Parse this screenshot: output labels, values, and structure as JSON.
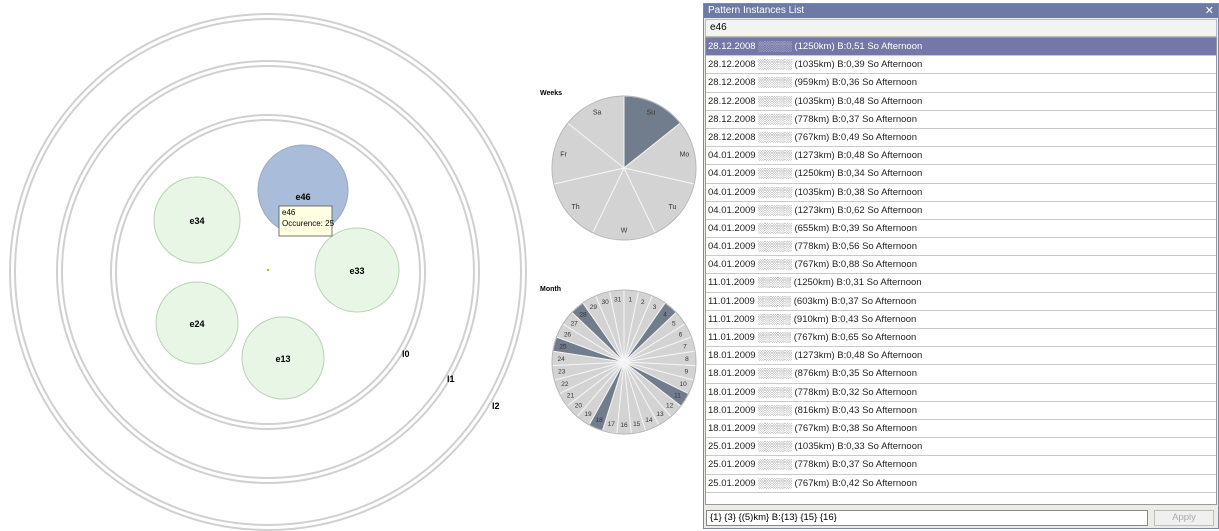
{
  "levels": [
    "l0",
    "l1",
    "l2"
  ],
  "nodes": [
    {
      "label": "e46",
      "selected": true
    },
    {
      "label": "e34"
    },
    {
      "label": "e33"
    },
    {
      "label": "e24"
    },
    {
      "label": "e13"
    }
  ],
  "tooltip": {
    "line1": "e46",
    "line2": "Occurence: 25"
  },
  "weeks": {
    "title": "Weeks",
    "days": [
      "Su",
      "Mo",
      "Tu",
      "W",
      "Th",
      "Fr",
      "Sa"
    ],
    "highlighted": [
      "Su"
    ]
  },
  "month": {
    "title": "Month",
    "days": [
      "1",
      "2",
      "3",
      "4",
      "5",
      "6",
      "7",
      "8",
      "9",
      "10",
      "11",
      "12",
      "13",
      "14",
      "15",
      "16",
      "17",
      "18",
      "19",
      "20",
      "21",
      "22",
      "23",
      "24",
      "25",
      "26",
      "27",
      "28",
      "29",
      "30",
      "31"
    ],
    "highlighted": [
      "4",
      "11",
      "18",
      "25",
      "28"
    ]
  },
  "colors": {
    "highlight": "#717d8c",
    "pie": "#d3d3d3",
    "selected_node": "#a9bcd9",
    "node": "#e8f6e5",
    "selected_row": "#7478a8"
  },
  "panel": {
    "title": "Pattern Instances List",
    "filter": "e46",
    "rows": [
      "28.12.2008 ​░░░░░ (1250km) B:0,51 So Afternoon",
      "28.12.2008 ░░░░░ (1035km) B:0,39 So Afternoon",
      "28.12.2008 ░░░░░ (959km) B:0,36 So Afternoon",
      "28.12.2008 ░░░░░ (1035km) B:0,48 So Afternoon",
      "28.12.2008 ░░░░░ (778km) B:0,37 So Afternoon",
      "28.12.2008 ░░░░░ (767km) B:0,49 So Afternoon",
      "04.01.2009 ░░░░░ (1273km) B:0,48 So Afternoon",
      "04.01.2009 ░░░░░ (1250km) B:0,34 So Afternoon",
      "04.01.2009 ░░░░░ (1035km) B:0,38 So Afternoon",
      "04.01.2009 ░░░░░ (1273km) B:0,62 So Afternoon",
      "04.01.2009 ░░░░░ (655km) B:0,39 So Afternoon",
      "04.01.2009 ░░░░░ (778km) B:0,56 So Afternoon",
      "04.01.2009 ░░░░░ (767km) B:0,88 So Afternoon",
      "11.01.2009 ░░░░░ (1250km) B:0,31 So Afternoon",
      "11.01.2009 ░░░░░ (603km) B:0,37 So Afternoon",
      "11.01.2009 ░░░░░ (910km) B:0,43 So Afternoon",
      "11.01.2009 ░░░░░ (767km) B:0,65 So Afternoon",
      "18.01.2009 ░░░░░ (1273km) B:0,48 So Afternoon",
      "18.01.2009 ░░░░░ (876km) B:0,35 So Afternoon",
      "18.01.2009 ░░░░░ (778km) B:0,32 So Afternoon",
      "18.01.2009 ░░░░░ (816km) B:0,43 So Afternoon",
      "18.01.2009 ░░░░░ (767km) B:0,38 So Afternoon",
      "25.01.2009 ░░░░░ (1035km) B:0,33 So Afternoon",
      "25.01.2009 ░░░░░ (778km) B:0,37 So Afternoon",
      "25.01.2009 ░░░░░ (767km) B:0,42 So Afternoon"
    ],
    "query": "{1} {3} {(5)km} B:{13} {15} {16}",
    "apply_label": "Apply"
  }
}
